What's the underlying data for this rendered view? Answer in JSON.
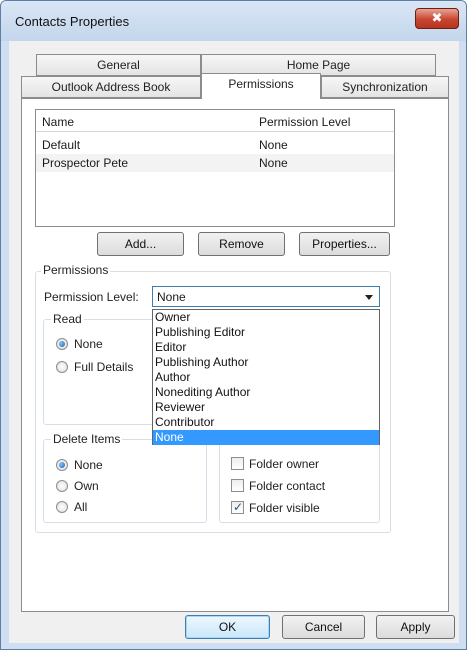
{
  "window": {
    "title": "Contacts Properties",
    "close_glyph": "✖"
  },
  "tabs": {
    "row1": [
      "General",
      "Home Page"
    ],
    "row2": [
      "Outlook Address Book",
      "Permissions",
      "Synchronization"
    ],
    "active": "Permissions"
  },
  "list": {
    "col_name": "Name",
    "col_level": "Permission Level",
    "rows": [
      {
        "name": "Default",
        "level": "None"
      },
      {
        "name": "Prospector Pete",
        "level": "None"
      }
    ]
  },
  "list_buttons": {
    "add": "Add...",
    "remove": "Remove",
    "properties": "Properties..."
  },
  "permissions": {
    "group_label": "Permissions",
    "level_label": "Permission Level:",
    "level_value": "None",
    "options": [
      "Owner",
      "Publishing Editor",
      "Editor",
      "Publishing Author",
      "Author",
      "Nonediting Author",
      "Reviewer",
      "Contributor",
      "None"
    ],
    "selected_option": "None"
  },
  "read": {
    "label": "Read",
    "options": [
      "None",
      "Full Details"
    ],
    "selected": "None"
  },
  "delete_items": {
    "label": "Delete Items",
    "options": [
      "None",
      "Own",
      "All"
    ],
    "selected": "None"
  },
  "other": {
    "checkboxes": [
      {
        "label": "Folder owner",
        "checked": false
      },
      {
        "label": "Folder contact",
        "checked": false
      },
      {
        "label": "Folder visible",
        "checked": true
      }
    ]
  },
  "footer": {
    "ok": "OK",
    "cancel": "Cancel",
    "apply": "Apply"
  },
  "colors": {
    "selection": "#3399ff",
    "titlebar": "#c3d6ec",
    "close_button": "#c84530"
  }
}
